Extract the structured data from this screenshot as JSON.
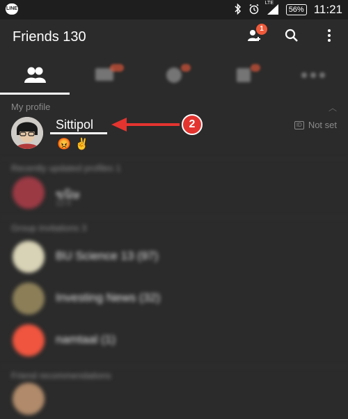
{
  "status": {
    "battery": "56%",
    "time": "11:21",
    "network": "LTE"
  },
  "header": {
    "title": "Friends 130",
    "add_friend_badge": "1"
  },
  "profile": {
    "section": "My profile",
    "name": "Sittipol",
    "id_label": "ID",
    "status_text": "Not set",
    "emojis": [
      "😡",
      "✌"
    ]
  },
  "annotation": {
    "step": "2"
  },
  "sections": {
    "recent": "Recently updated profiles 1",
    "groups": "Group invitations 3",
    "recommend": "Friend recommendations"
  },
  "rows": [
    {
      "name": "ขนิษ",
      "sub": "12-4"
    },
    {
      "name": "BU Science 13 (97)"
    },
    {
      "name": "Investing News (32)"
    },
    {
      "name": "namtaal (1)"
    }
  ]
}
